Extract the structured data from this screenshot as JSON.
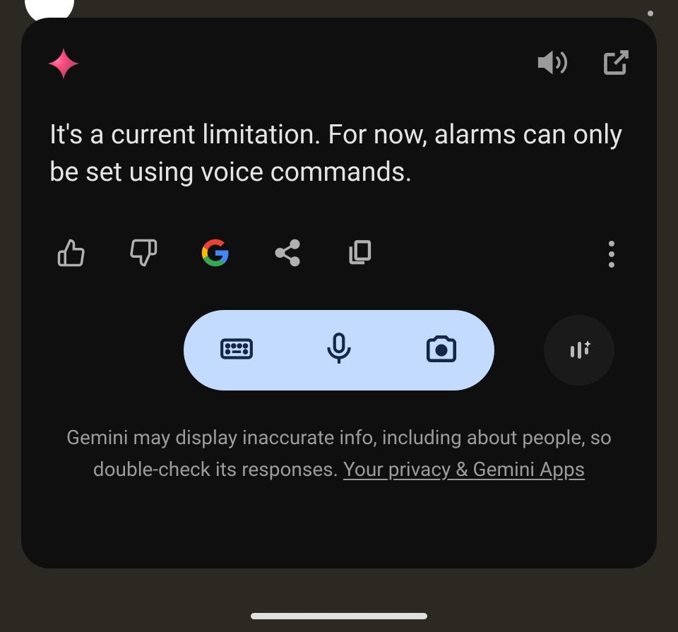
{
  "response": {
    "text": "It's a current limitation. For now, alarms can only be set using voice commands."
  },
  "icons": {
    "gemini_spark": "gemini-spark-icon",
    "speaker": "speaker-icon",
    "open_new": "open-in-new-icon",
    "thumb_up": "thumb-up-icon",
    "thumb_down": "thumb-down-icon",
    "google": "google-icon",
    "share": "share-icon",
    "copy": "copy-icon",
    "more": "more-icon",
    "keyboard": "keyboard-icon",
    "mic": "microphone-icon",
    "camera": "camera-icon",
    "ai_suggest": "ai-suggest-icon"
  },
  "disclaimer": {
    "text_part1": "Gemini may display inaccurate info, including about people, so double-check its responses. ",
    "link_text": "Your privacy & Gemini Apps"
  }
}
